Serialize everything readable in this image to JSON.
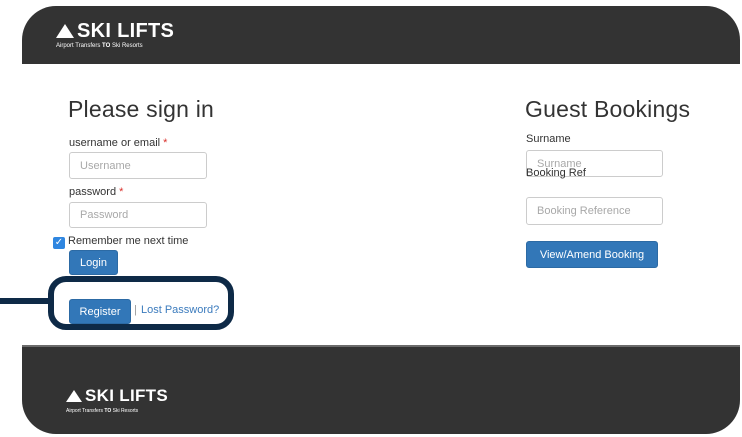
{
  "brand": {
    "name": "SKI LIFTS",
    "tagline_pre": "Airport Transfers",
    "tagline_bold": "TO",
    "tagline_post": "Ski Resorts"
  },
  "signin": {
    "title": "Please sign in",
    "username_label": "username or email",
    "username_placeholder": "Username",
    "password_label": "password",
    "password_placeholder": "Password",
    "required_mark": "*",
    "remember_label": "Remember me next time",
    "remember_checked": true,
    "login_label": "Login",
    "register_label": "Register",
    "separator": "|",
    "lost_password_label": "Lost Password?"
  },
  "guest": {
    "title": "Guest Bookings",
    "surname_label": "Surname",
    "surname_placeholder": "Surname",
    "ref_label": "Booking Ref",
    "ref_placeholder": "Booking Reference",
    "view_button_label": "View/Amend Booking"
  },
  "colors": {
    "header_bg": "#333333",
    "primary_button": "#3277b8",
    "highlight_ring": "#0e2a47",
    "required": "#d9302b"
  }
}
